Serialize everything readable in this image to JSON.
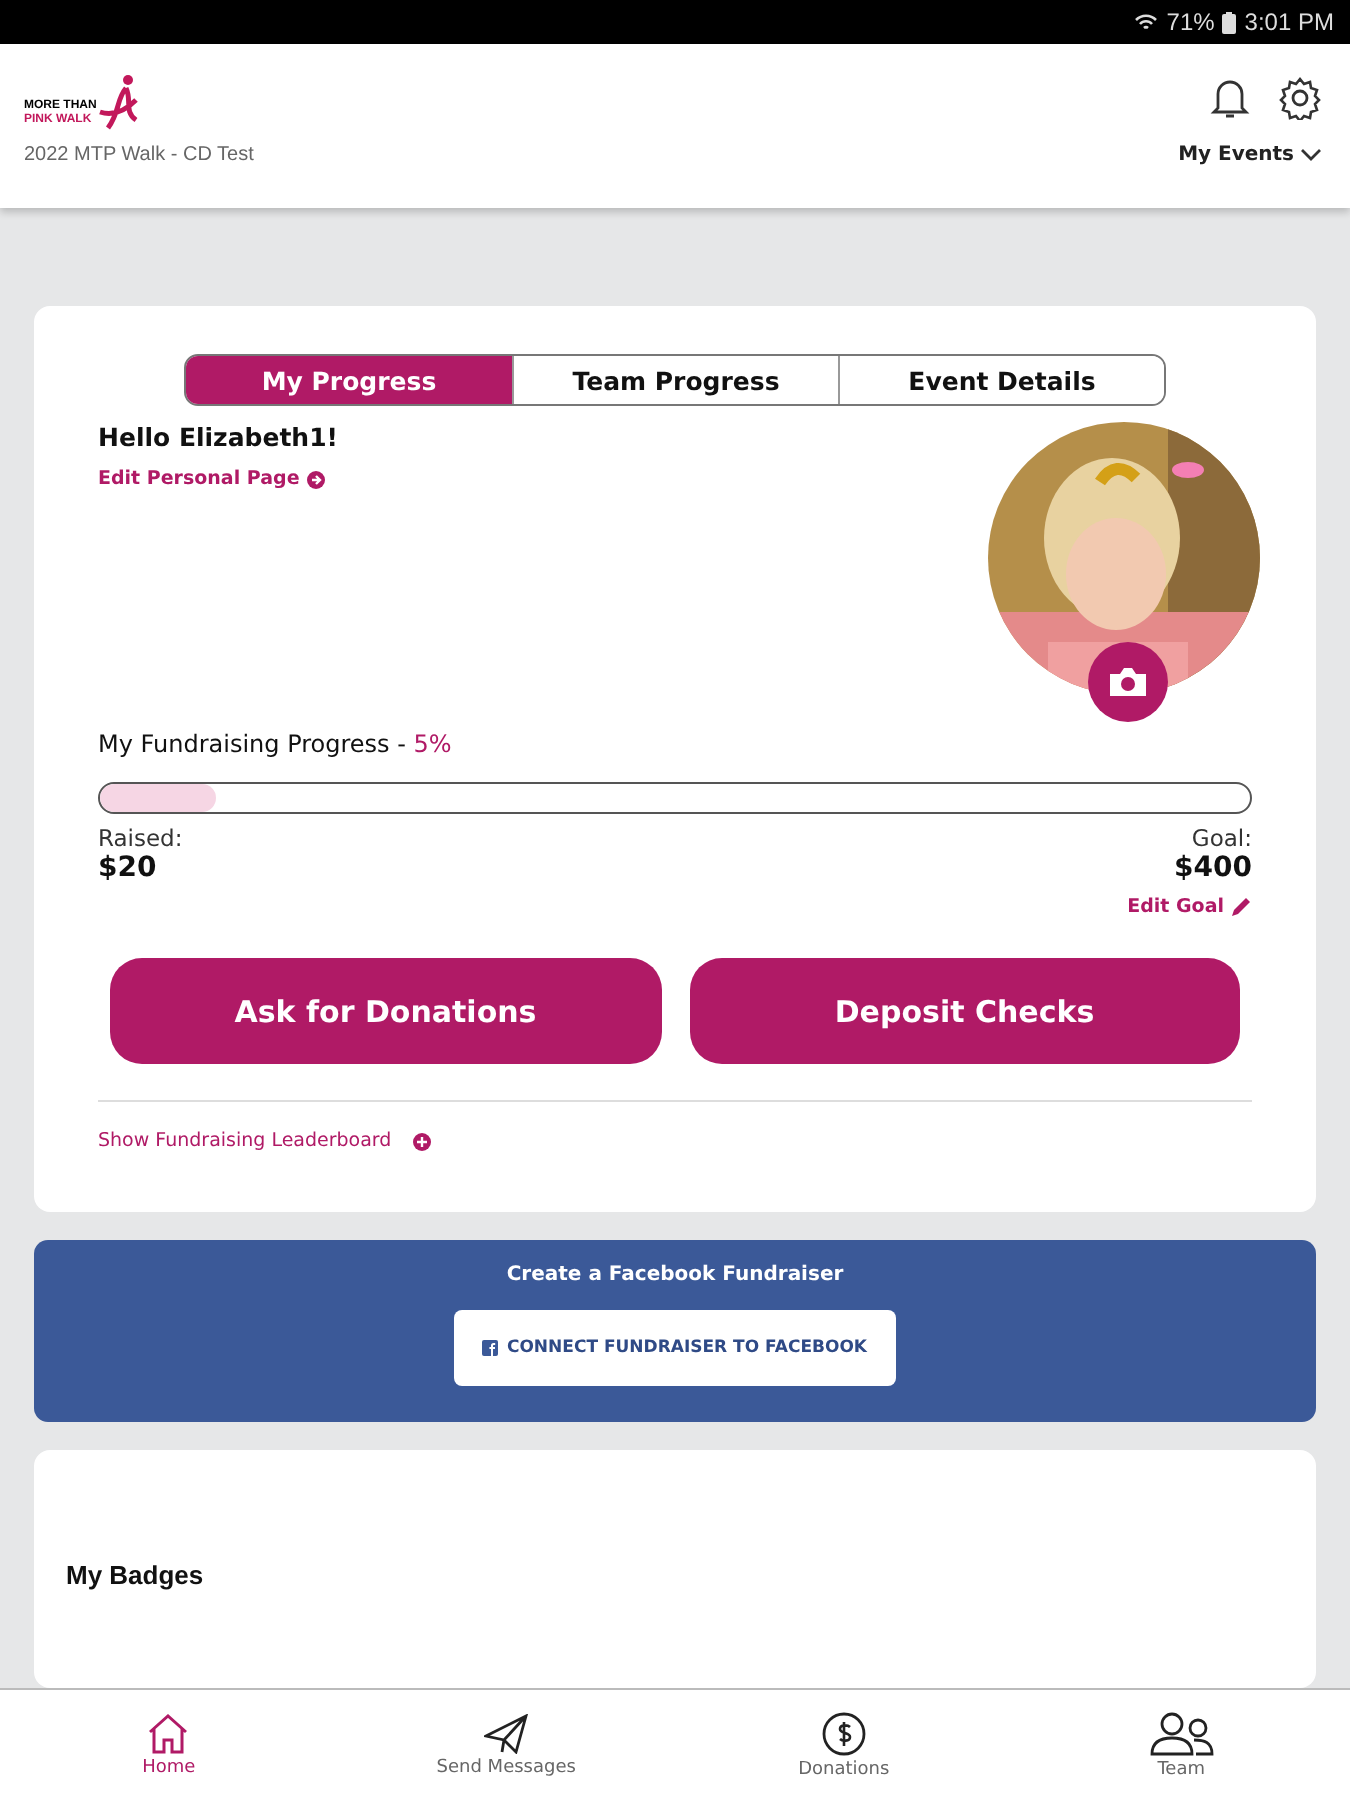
{
  "status_bar": {
    "battery": "71%",
    "time": "3:01 PM"
  },
  "header": {
    "logo_line1": "MORE THAN",
    "logo_line2": "PINK WALK",
    "event": "2022 MTP Walk - CD Test",
    "menu": "My Events"
  },
  "tabs": [
    {
      "label": "My Progress",
      "selected": true
    },
    {
      "label": "Team Progress",
      "selected": false
    },
    {
      "label": "Event Details",
      "selected": false
    }
  ],
  "progress": {
    "greeting": "Hello Elizabeth1!",
    "edit_page": "Edit Personal Page",
    "title": "My Fundraising Progress - ",
    "percent": "5%",
    "level": 0.1,
    "raised_label": "Raised:",
    "raised": "$20",
    "goal_label": "Goal:",
    "goal": "$400",
    "edit_goal": "Edit Goal",
    "buttons": [
      "Ask for Donations",
      "Deposit Checks"
    ],
    "leaderboard": "Show Fundraising Leaderboard"
  },
  "facebook": {
    "title": "Create a Facebook Fundraiser",
    "button": "CONNECT FUNDRAISER TO FACEBOOK"
  },
  "badges": {
    "title": "My Badges"
  },
  "nav": [
    {
      "label": "Home",
      "selected": true
    },
    {
      "label": "Send Messages",
      "selected": false
    },
    {
      "label": "Donations",
      "selected": false
    },
    {
      "label": "Team",
      "selected": false
    }
  ]
}
